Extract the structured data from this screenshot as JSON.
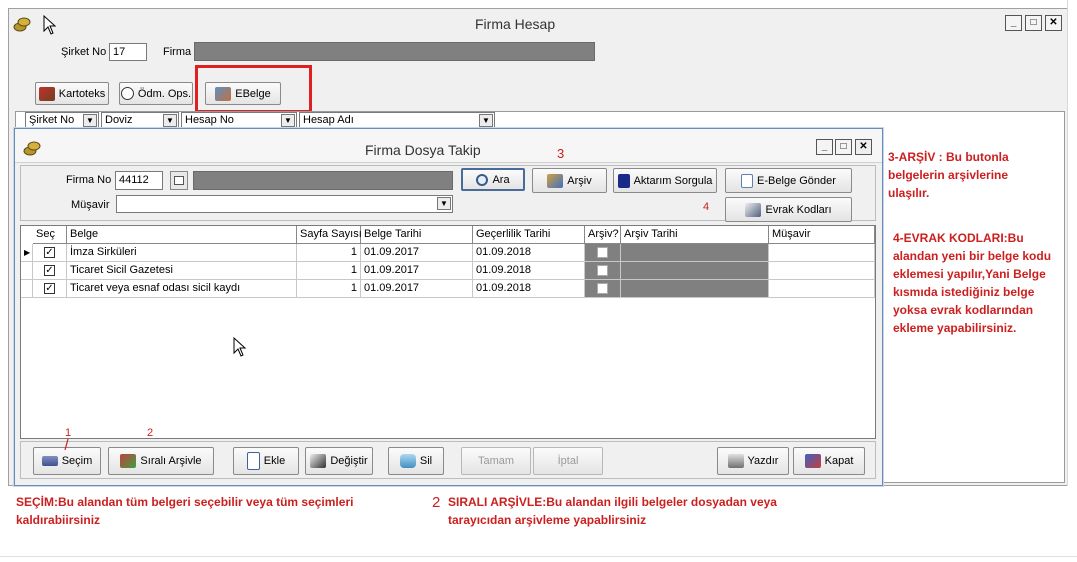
{
  "outer": {
    "title": "Firma Hesap",
    "sirket_no_label": "Şirket No",
    "sirket_no_value": "17",
    "firma_label": "Firma",
    "buttons": {
      "kartoteks": "Kartoteks",
      "odm_ops": "Ödm. Ops.",
      "ebelge": "EBelge"
    },
    "filters": [
      "Şirket No",
      "Doviz",
      "Hesap No",
      "Hesap Adı"
    ]
  },
  "inner": {
    "title": "Firma Dosya Takip",
    "firma_no_label": "Firma No",
    "firma_no_value": "44112",
    "musavir_label": "Müşavir",
    "buttons": {
      "ara": "Ara",
      "arsiv": "Arşiv",
      "aktarim": "Aktarım Sorgula",
      "ebelge_gonder": "E-Belge Gönder",
      "evrak_kodlari": "Evrak Kodları"
    },
    "columns": [
      "Seç",
      "Belge",
      "Sayfa Sayısı",
      "Belge Tarihi",
      "Geçerlilik Tarihi",
      "Arşiv?",
      "Arşiv Tarihi",
      "Müşavir"
    ],
    "rows": [
      {
        "belge": "İmza Sirküleri",
        "sayfa": "1",
        "belge_tarihi": "01.09.2017",
        "gecerlilik": "01.09.2018"
      },
      {
        "belge": "Ticaret Sicil Gazetesi",
        "sayfa": "1",
        "belge_tarihi": "01.09.2017",
        "gecerlilik": "01.09.2018"
      },
      {
        "belge": "Ticaret veya esnaf odası sicil kaydı",
        "sayfa": "1",
        "belge_tarihi": "01.09.2017",
        "gecerlilik": "01.09.2018"
      }
    ],
    "bottom_buttons": {
      "secim": "Seçim",
      "sirali": "Sıralı Arşivle",
      "ekle": "Ekle",
      "degistir": "Değiştir",
      "sil": "Sil",
      "tamam": "Tamam",
      "iptal": "İptal",
      "yazdir": "Yazdır",
      "kapat": "Kapat"
    }
  },
  "annotations": {
    "n1": "1",
    "n2": "2",
    "n3": "3",
    "n4": "4",
    "arsiv_note": "3-ARŞİV : Bu butonla belgelerin arşivlerine ulaşılır.",
    "evrak_note": "4-EVRAK KODLARI:Bu alandan yeni bir belge kodu eklemesi yapılır,Yani Belge kısmıda istediğiniz belge yoksa evrak kodlarından ekleme yapabilirsiniz.",
    "secim_note": "SEÇİM:Bu alandan tüm belgeri seçebilir veya tüm seçimleri kaldırabiirsiniz",
    "sirali_num": "2",
    "sirali_note": "SIRALI ARŞİVLE:Bu alandan ilgili belgeler dosyadan veya tarayıcıdan arşivleme yapablirsiniz",
    "accent_red": "#cc1f1f"
  }
}
